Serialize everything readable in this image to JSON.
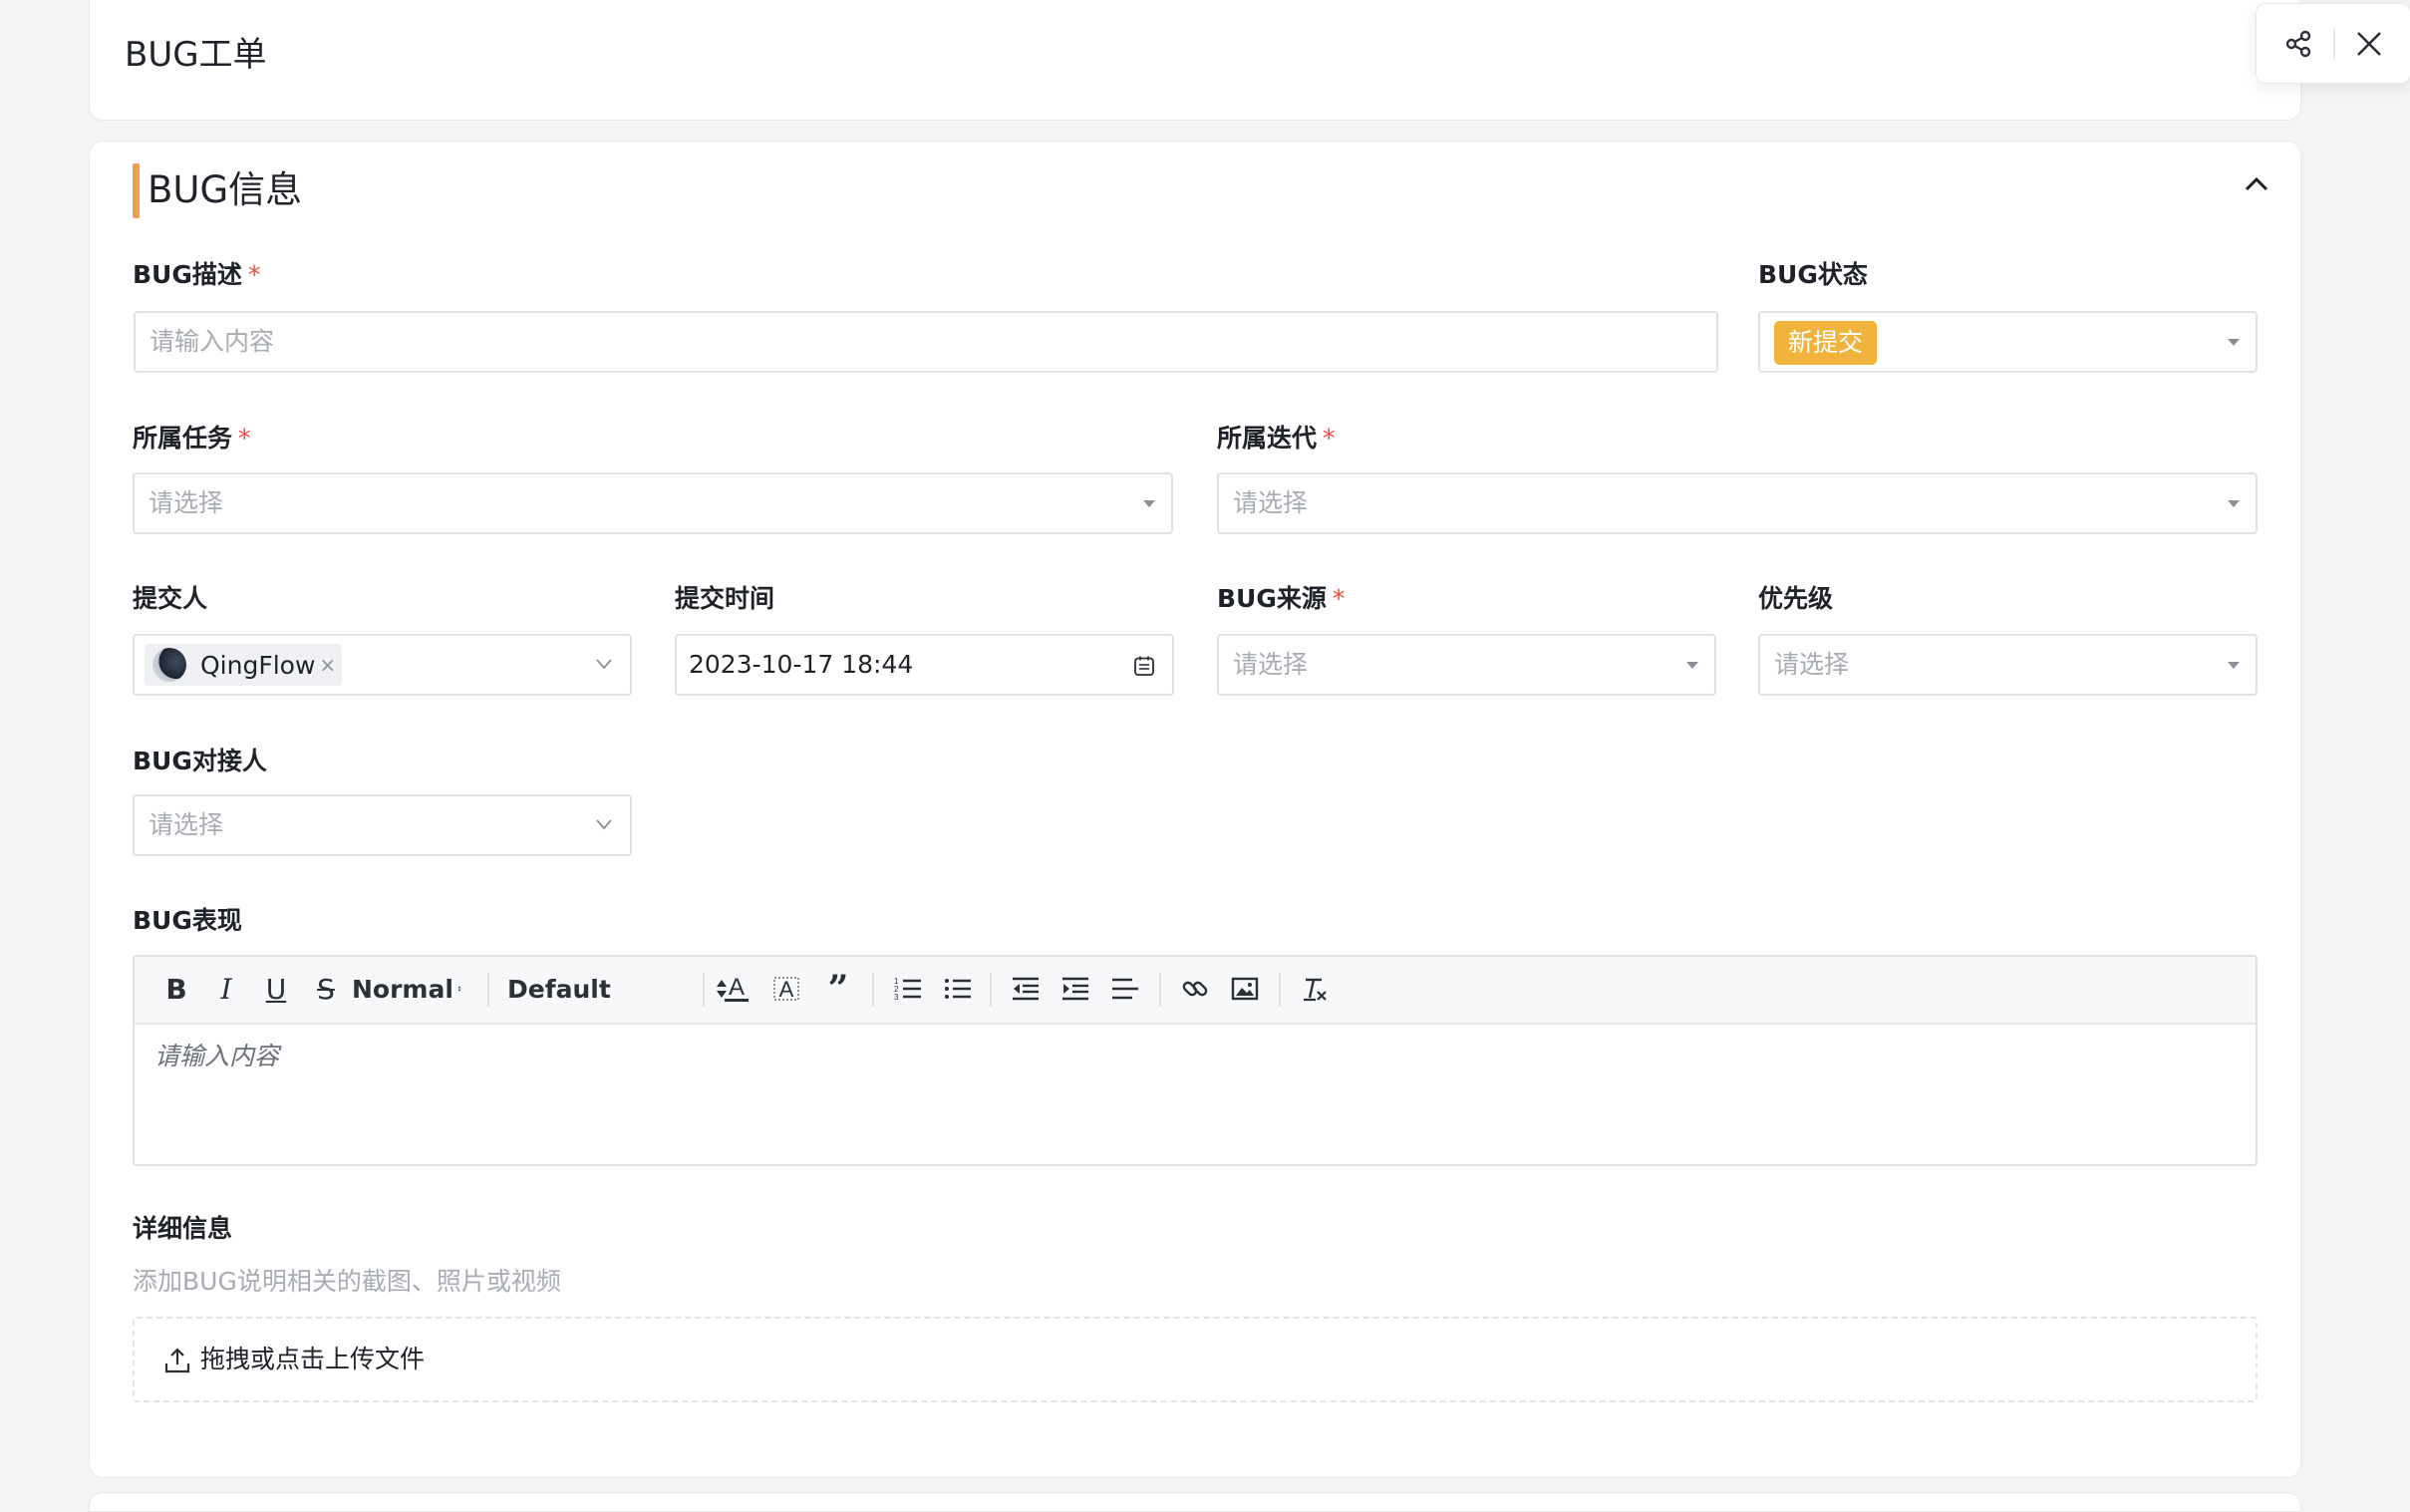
{
  "form": {
    "title": "BUG工单"
  },
  "actions": {
    "share_icon": "share-icon",
    "close_icon": "close-icon"
  },
  "section": {
    "title": "BUG信息",
    "collapse_icon": "chevron-up-icon",
    "accent": "#f0a04b"
  },
  "fields": {
    "bug_desc": {
      "label": "BUG描述",
      "required": "*",
      "placeholder": "请输入内容"
    },
    "bug_status": {
      "label": "BUG状态",
      "value": "新提交",
      "tag_color": "#f0b43c"
    },
    "task": {
      "label": "所属任务",
      "required": "*",
      "placeholder": "请选择"
    },
    "iteration": {
      "label": "所属迭代",
      "required": "*",
      "placeholder": "请选择"
    },
    "submitter": {
      "label": "提交人",
      "value": "QingFlow",
      "remove": "×"
    },
    "submit_time": {
      "label": "提交时间",
      "value": "2023-10-17 18:44"
    },
    "bug_source": {
      "label": "BUG来源",
      "required": "*",
      "placeholder": "请选择"
    },
    "priority": {
      "label": "优先级",
      "placeholder": "请选择"
    },
    "contact": {
      "label": "BUG对接人",
      "placeholder": "请选择"
    },
    "bug_behavior": {
      "label": "BUG表现",
      "placeholder": "请输入内容"
    },
    "details": {
      "label": "详细信息",
      "hint": "添加BUG说明相关的截图、照片或视频",
      "upload_text": "拖拽或点击上传文件"
    }
  },
  "editor_toolbar": {
    "header_select": "Normal",
    "font_select": "Default"
  }
}
